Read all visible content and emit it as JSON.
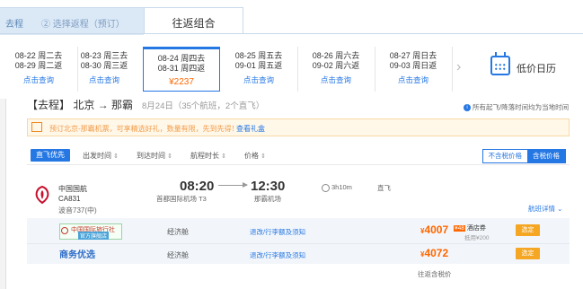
{
  "tabs": {
    "step1_text": "去程",
    "step2_text": "② 选择返程（预订）",
    "combo_label": "往返组合"
  },
  "dates": [
    {
      "d1": "08-22 周二去",
      "d2": "08-29 周二返",
      "action": "点击查询"
    },
    {
      "d1": "08-23 周三去",
      "d2": "08-30 周三返",
      "action": "点击查询"
    },
    {
      "d1": "08-24 周四去",
      "d2": "08-31 周四返",
      "action": "¥2237"
    },
    {
      "d1": "08-25 周五去",
      "d2": "09-01 周五返",
      "action": "点击查询"
    },
    {
      "d1": "08-26 周六去",
      "d2": "09-02 周六返",
      "action": "点击查询"
    },
    {
      "d1": "08-27 周日去",
      "d2": "09-03 周日返",
      "action": "点击查询"
    }
  ],
  "calendar_label": "低价日历",
  "leg": {
    "title": "【去程】 北京 → 那霸",
    "meta": "8月24日（35个航班，2个直飞）",
    "note": "所有起飞/降落时间均为当地时间"
  },
  "promo": {
    "text": "预订北京-那霸机票，可享精选好礼，数量有限，先到先得！",
    "link": "查看礼盒"
  },
  "filters": {
    "direct_label": "直飞优先",
    "items": [
      "出发时间",
      "到达时间",
      "航程时长",
      "价格"
    ],
    "toggle_off": "不含税价格",
    "toggle_on": "含税价格"
  },
  "flight": {
    "airline": "中国国航",
    "flight_no": "CA831",
    "plane": "波音737(中)",
    "dep_time": "08:20",
    "dep_airport": "首都国际机场 T3",
    "arr_time": "12:30",
    "arr_airport": "那霸机场",
    "duration": "3h10m",
    "stops": "直飞",
    "details": "航班详情 ⌄"
  },
  "fares": [
    {
      "brand": "中国国际旅行社",
      "brand_sub": "官方旗舰店",
      "cabin": "经济舱",
      "rules": "退改/行李额及须知",
      "price": "4007",
      "coupon_tag": "¥48",
      "coupon": "酒店券",
      "coupon_sub": "抵用¥200",
      "book": "选定"
    },
    {
      "brand": "商务优选",
      "cabin": "经济舱",
      "rules": "退改/行李额及须知",
      "price": "4072",
      "book": "选定"
    }
  ],
  "bottom_note": "往返含税价",
  "colors": {
    "accent": "#2577e3",
    "price": "#ff6600",
    "book": "#f5a623"
  }
}
